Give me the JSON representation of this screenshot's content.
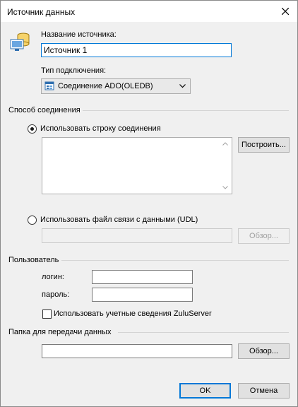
{
  "window": {
    "title": "Источник данных"
  },
  "source": {
    "name_label": "Название источника:",
    "name_value": "Источник 1",
    "connection_type_label": "Тип подключения:",
    "connection_type_value": "Соединение ADO(OLEDB)"
  },
  "connection": {
    "group_label": "Способ соединения",
    "use_string_label": "Использовать строку соединения",
    "connection_string": "",
    "build_button": "Построить...",
    "use_udl_label": "Использовать файл связи с данными (UDL)",
    "udl_path": "",
    "browse_button": "Обзор..."
  },
  "user": {
    "group_label": "Пользователь",
    "login_label": "логин:",
    "login_value": "",
    "password_label": "пароль:",
    "password_value": "",
    "use_zulu_label": "Использовать учетные сведения ZuluServer"
  },
  "transfer": {
    "group_label": "Папка для передачи данных",
    "folder_value": "",
    "browse_button": "Обзор..."
  },
  "footer": {
    "ok_label": "OK",
    "cancel_label": "Отмена"
  },
  "state": {
    "selected_method": "string",
    "use_zulu_checked": false
  },
  "colors": {
    "focus": "#0078d7",
    "window_bg": "#f0f0f0"
  }
}
